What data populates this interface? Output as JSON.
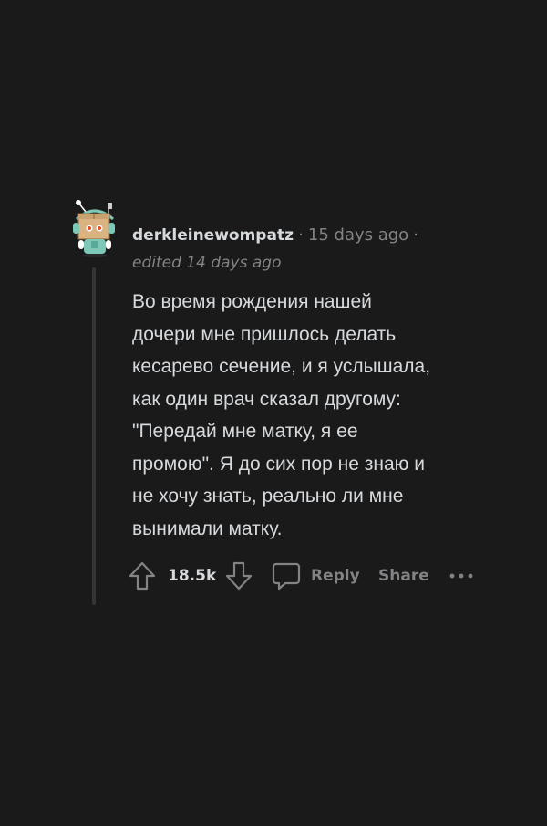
{
  "comment": {
    "username": "derkleinewompatz",
    "separator": "·",
    "time": "15 days ago",
    "edited": "edited 14 days ago",
    "body_lines": [
      "Во время рождения нашей",
      "дочери мне пришлось делать",
      "кесарево сечение, и я услышала,",
      "как один врач сказал другому:",
      "\"Передай мне матку, я ее",
      "промою\". Я до сих пор не знаю и",
      "не хочу знать, реально ли мне",
      "вынимали матку."
    ],
    "avatar_icon": "snoo-avatar-box-head"
  },
  "actions": {
    "upvote_icon": "upvote-arrow-icon",
    "score": "18.5k",
    "downvote_icon": "downvote-arrow-icon",
    "reply_icon": "speech-bubble-icon",
    "reply_label": "Reply",
    "share_label": "Share",
    "more_icon": "more-dots-icon"
  },
  "colors": {
    "background": "#1a1a1b",
    "text_primary": "#d7dadc",
    "text_muted": "#818384",
    "thread_line": "#343536"
  }
}
